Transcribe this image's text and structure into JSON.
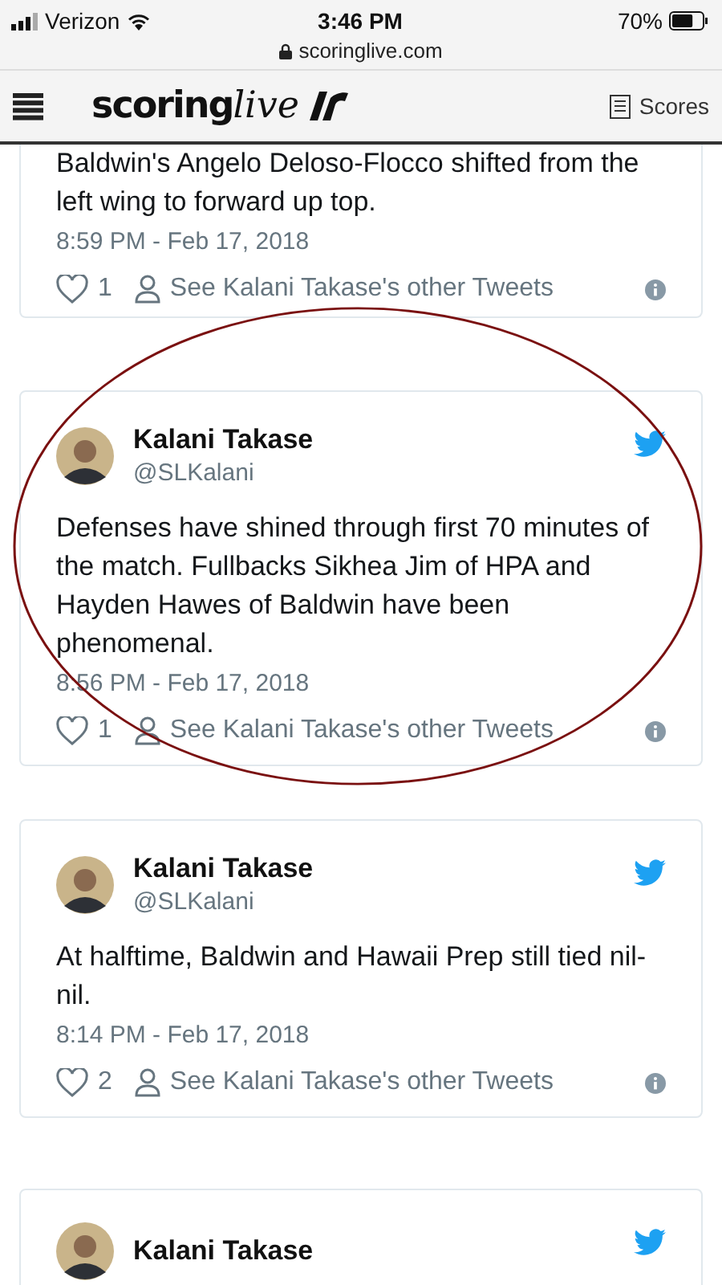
{
  "status_bar": {
    "carrier": "Verizon",
    "time": "3:46 PM",
    "battery": "70%",
    "url": "scoringlive.com"
  },
  "header": {
    "logo_bold": "scoring",
    "logo_script": "live",
    "scores_link": "Scores"
  },
  "tweets": [
    {
      "text": "Baldwin's Angelo Deloso-Flocco shifted from the left wing to forward up top.",
      "time": "8:59 PM - Feb 17, 2018",
      "likes": "1",
      "other_link": "See Kalani Takase's other Tweets",
      "circled": false
    },
    {
      "author": "Kalani Takase",
      "handle": "@SLKalani",
      "text": "Defenses have shined through first 70 minutes of the match. Fullbacks Sikhea Jim of HPA and Hayden Hawes of Baldwin have been phenomenal.",
      "time": "8:56 PM - Feb 17, 2018",
      "likes": "1",
      "other_link": "See Kalani Takase's other Tweets",
      "circled": true
    },
    {
      "author": "Kalani Takase",
      "handle": "@SLKalani",
      "text": "At halftime, Baldwin and Hawaii Prep still tied nil-nil.",
      "time": "8:14 PM - Feb 17, 2018",
      "likes": "2",
      "other_link": "See Kalani Takase's other Tweets",
      "circled": false
    },
    {
      "author": "Kalani Takase",
      "circled": false
    }
  ]
}
